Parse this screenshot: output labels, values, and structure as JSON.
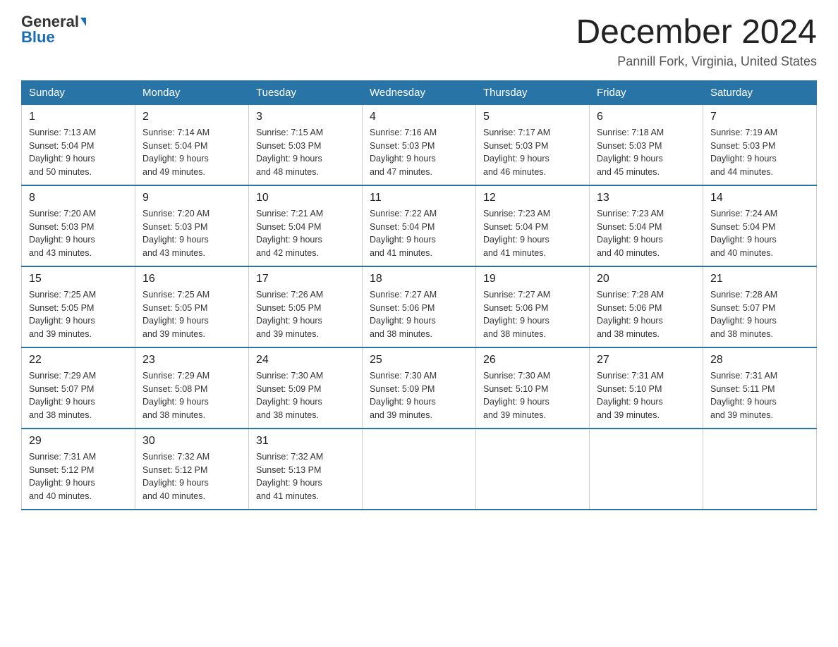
{
  "header": {
    "logo_general": "General",
    "logo_blue": "Blue",
    "month_title": "December 2024",
    "location": "Pannill Fork, Virginia, United States"
  },
  "days_of_week": [
    "Sunday",
    "Monday",
    "Tuesday",
    "Wednesday",
    "Thursday",
    "Friday",
    "Saturday"
  ],
  "weeks": [
    [
      {
        "day": "1",
        "sunrise": "7:13 AM",
        "sunset": "5:04 PM",
        "daylight": "9 hours and 50 minutes."
      },
      {
        "day": "2",
        "sunrise": "7:14 AM",
        "sunset": "5:04 PM",
        "daylight": "9 hours and 49 minutes."
      },
      {
        "day": "3",
        "sunrise": "7:15 AM",
        "sunset": "5:03 PM",
        "daylight": "9 hours and 48 minutes."
      },
      {
        "day": "4",
        "sunrise": "7:16 AM",
        "sunset": "5:03 PM",
        "daylight": "9 hours and 47 minutes."
      },
      {
        "day": "5",
        "sunrise": "7:17 AM",
        "sunset": "5:03 PM",
        "daylight": "9 hours and 46 minutes."
      },
      {
        "day": "6",
        "sunrise": "7:18 AM",
        "sunset": "5:03 PM",
        "daylight": "9 hours and 45 minutes."
      },
      {
        "day": "7",
        "sunrise": "7:19 AM",
        "sunset": "5:03 PM",
        "daylight": "9 hours and 44 minutes."
      }
    ],
    [
      {
        "day": "8",
        "sunrise": "7:20 AM",
        "sunset": "5:03 PM",
        "daylight": "9 hours and 43 minutes."
      },
      {
        "day": "9",
        "sunrise": "7:20 AM",
        "sunset": "5:03 PM",
        "daylight": "9 hours and 43 minutes."
      },
      {
        "day": "10",
        "sunrise": "7:21 AM",
        "sunset": "5:04 PM",
        "daylight": "9 hours and 42 minutes."
      },
      {
        "day": "11",
        "sunrise": "7:22 AM",
        "sunset": "5:04 PM",
        "daylight": "9 hours and 41 minutes."
      },
      {
        "day": "12",
        "sunrise": "7:23 AM",
        "sunset": "5:04 PM",
        "daylight": "9 hours and 41 minutes."
      },
      {
        "day": "13",
        "sunrise": "7:23 AM",
        "sunset": "5:04 PM",
        "daylight": "9 hours and 40 minutes."
      },
      {
        "day": "14",
        "sunrise": "7:24 AM",
        "sunset": "5:04 PM",
        "daylight": "9 hours and 40 minutes."
      }
    ],
    [
      {
        "day": "15",
        "sunrise": "7:25 AM",
        "sunset": "5:05 PM",
        "daylight": "9 hours and 39 minutes."
      },
      {
        "day": "16",
        "sunrise": "7:25 AM",
        "sunset": "5:05 PM",
        "daylight": "9 hours and 39 minutes."
      },
      {
        "day": "17",
        "sunrise": "7:26 AM",
        "sunset": "5:05 PM",
        "daylight": "9 hours and 39 minutes."
      },
      {
        "day": "18",
        "sunrise": "7:27 AM",
        "sunset": "5:06 PM",
        "daylight": "9 hours and 38 minutes."
      },
      {
        "day": "19",
        "sunrise": "7:27 AM",
        "sunset": "5:06 PM",
        "daylight": "9 hours and 38 minutes."
      },
      {
        "day": "20",
        "sunrise": "7:28 AM",
        "sunset": "5:06 PM",
        "daylight": "9 hours and 38 minutes."
      },
      {
        "day": "21",
        "sunrise": "7:28 AM",
        "sunset": "5:07 PM",
        "daylight": "9 hours and 38 minutes."
      }
    ],
    [
      {
        "day": "22",
        "sunrise": "7:29 AM",
        "sunset": "5:07 PM",
        "daylight": "9 hours and 38 minutes."
      },
      {
        "day": "23",
        "sunrise": "7:29 AM",
        "sunset": "5:08 PM",
        "daylight": "9 hours and 38 minutes."
      },
      {
        "day": "24",
        "sunrise": "7:30 AM",
        "sunset": "5:09 PM",
        "daylight": "9 hours and 38 minutes."
      },
      {
        "day": "25",
        "sunrise": "7:30 AM",
        "sunset": "5:09 PM",
        "daylight": "9 hours and 39 minutes."
      },
      {
        "day": "26",
        "sunrise": "7:30 AM",
        "sunset": "5:10 PM",
        "daylight": "9 hours and 39 minutes."
      },
      {
        "day": "27",
        "sunrise": "7:31 AM",
        "sunset": "5:10 PM",
        "daylight": "9 hours and 39 minutes."
      },
      {
        "day": "28",
        "sunrise": "7:31 AM",
        "sunset": "5:11 PM",
        "daylight": "9 hours and 39 minutes."
      }
    ],
    [
      {
        "day": "29",
        "sunrise": "7:31 AM",
        "sunset": "5:12 PM",
        "daylight": "9 hours and 40 minutes."
      },
      {
        "day": "30",
        "sunrise": "7:32 AM",
        "sunset": "5:12 PM",
        "daylight": "9 hours and 40 minutes."
      },
      {
        "day": "31",
        "sunrise": "7:32 AM",
        "sunset": "5:13 PM",
        "daylight": "9 hours and 41 minutes."
      },
      null,
      null,
      null,
      null
    ]
  ],
  "labels": {
    "sunrise": "Sunrise:",
    "sunset": "Sunset:",
    "daylight": "Daylight:"
  }
}
